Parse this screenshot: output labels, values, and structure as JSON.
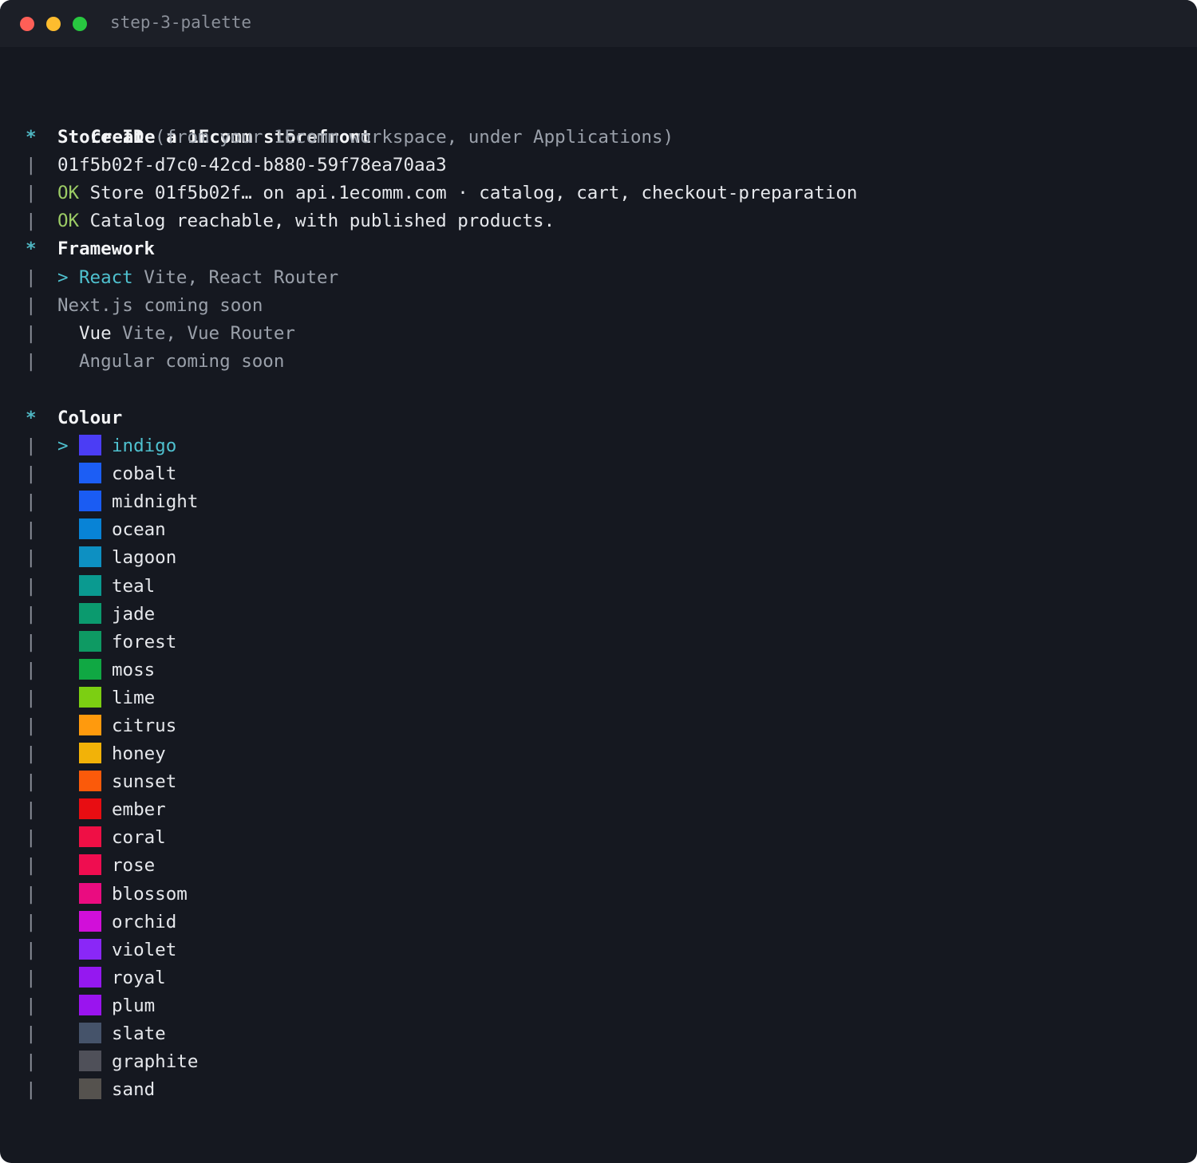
{
  "window": {
    "title": "step-3-palette"
  },
  "prompt": {
    "heading": "Create a 1Ecomm storefront",
    "store_id": {
      "marker": "*",
      "label": "Store ID",
      "hint": " (from your 1Ecomm workspace, under Applications)",
      "value": "01f5b02f-d7c0-42cd-b880-59f78ea70aa3",
      "checks": [
        {
          "status": "OK",
          "text": " Store 01f5b02f… on api.1ecomm.com · catalog, cart, checkout-preparation"
        },
        {
          "status": "OK",
          "text": " Catalog reachable, with published products."
        }
      ]
    },
    "framework": {
      "marker": "*",
      "label": "Framework",
      "cursor": ">",
      "options": [
        {
          "name": "React",
          "detail": " Vite, React Router",
          "selected": true,
          "available": true
        },
        {
          "name": "Next.js",
          "detail": " coming soon",
          "selected": false,
          "available": false
        },
        {
          "name": "Vue",
          "detail": " Vite, Vue Router",
          "selected": false,
          "available": true
        },
        {
          "name": "Angular",
          "detail": " coming soon",
          "selected": false,
          "available": false
        }
      ]
    },
    "colour": {
      "marker": "*",
      "label": "Colour",
      "cursor": ">",
      "options": [
        {
          "name": "indigo",
          "color": "#4b3df5",
          "selected": true
        },
        {
          "name": "cobalt",
          "color": "#1c5ef5"
        },
        {
          "name": "midnight",
          "color": "#1a5cf3"
        },
        {
          "name": "ocean",
          "color": "#0883d6"
        },
        {
          "name": "lagoon",
          "color": "#0d90c2"
        },
        {
          "name": "teal",
          "color": "#0a9a90"
        },
        {
          "name": "jade",
          "color": "#0b9a6e"
        },
        {
          "name": "forest",
          "color": "#0e9a63"
        },
        {
          "name": "moss",
          "color": "#10a843"
        },
        {
          "name": "lime",
          "color": "#7ccf12"
        },
        {
          "name": "citrus",
          "color": "#ff9a0d"
        },
        {
          "name": "honey",
          "color": "#f2b208"
        },
        {
          "name": "sunset",
          "color": "#fb5a0a"
        },
        {
          "name": "ember",
          "color": "#e80d12"
        },
        {
          "name": "coral",
          "color": "#ef0f45"
        },
        {
          "name": "rose",
          "color": "#ef0d50"
        },
        {
          "name": "blossom",
          "color": "#ea0c80"
        },
        {
          "name": "orchid",
          "color": "#d10fd9"
        },
        {
          "name": "violet",
          "color": "#8a27f7"
        },
        {
          "name": "royal",
          "color": "#9518f0"
        },
        {
          "name": "plum",
          "color": "#9a14ef"
        },
        {
          "name": "slate",
          "color": "#45536a"
        },
        {
          "name": "graphite",
          "color": "#4f5059"
        },
        {
          "name": "sand",
          "color": "#55524e"
        }
      ]
    },
    "gutter_char": "|"
  }
}
